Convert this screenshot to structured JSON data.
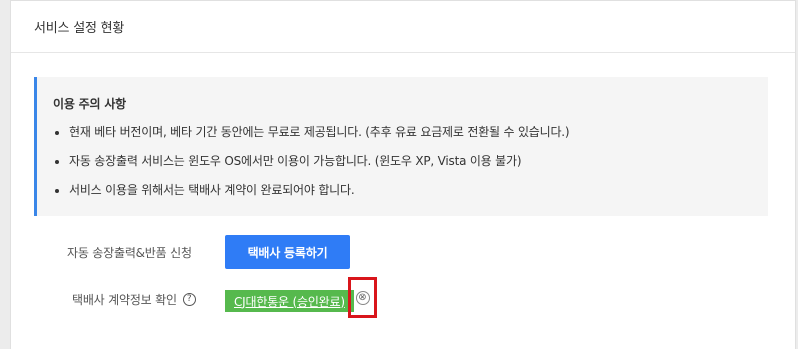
{
  "header": {
    "title": "서비스 설정 현황"
  },
  "notice": {
    "title": "이용 주의 사항",
    "items": [
      "현재 베타 버전이며, 베타 기간 동안에는 무료로 제공됩니다. (추후 유료 요금제로 전환될 수 있습니다.)",
      "자동 송장출력 서비스는 윈도우 OS에서만 이용이 가능합니다. (윈도우 XP, Vista 이용 불가)",
      "서비스 이용을 위해서는 택배사 계약이 완료되어야 합니다."
    ],
    "accent_color": "#3a86e8"
  },
  "auto_invoice": {
    "label": "자동 송장출력&반품 신청",
    "button_label": "택배사 등록하기",
    "button_color": "#2f7cf6"
  },
  "carrier_contract": {
    "label": "택배사 계약정보 확인",
    "help_icon": "?",
    "badge_label": "CJ대한통운 (승인완료)",
    "badge_color": "#56b94d",
    "remove_icon": "⊗",
    "highlight_color": "#d9151b"
  }
}
